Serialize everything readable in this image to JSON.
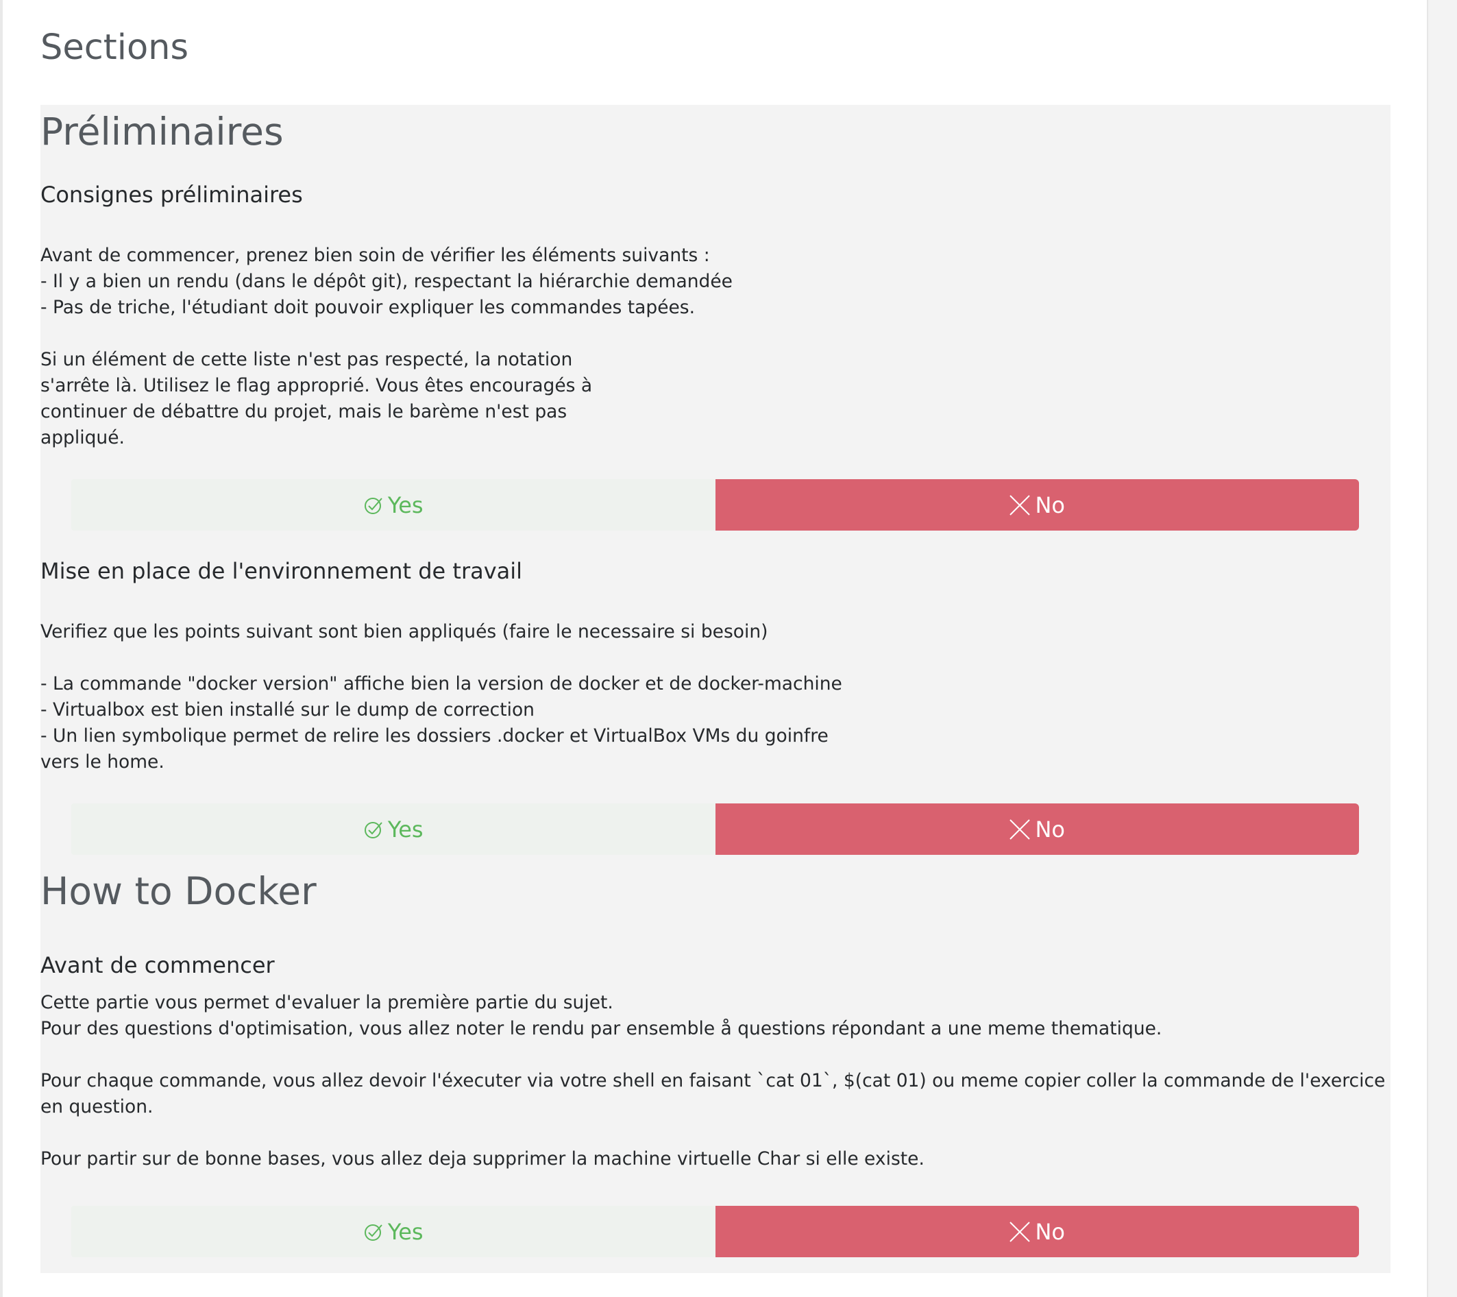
{
  "page": {
    "title": "Sections"
  },
  "sections": [
    {
      "title": "Préliminaires",
      "questions": [
        {
          "title": "Consignes préliminaires",
          "text": "Avant de commencer, prenez bien soin de vérifier les éléments suivants :\n- Il y a bien un rendu (dans le dépôt git), respectant la hiérarchie demandée\n- Pas de triche, l'étudiant doit pouvoir expliquer les commandes tapées.\n\nSi un élément de cette liste n'est pas respecté, la notation\ns'arrête là. Utilisez le flag approprié. Vous êtes encouragés à\ncontinuer de débattre du projet, mais le barème n'est pas\nappliqué.",
          "yes_label": "Yes",
          "no_label": "No"
        },
        {
          "title": "Mise en place de l'environnement de travail",
          "text": "Verifiez que les points suivant sont bien appliqués (faire le necessaire si besoin)\n\n- La commande \"docker version\" affiche bien la version de docker et de docker-machine\n- Virtualbox est bien installé sur le dump de correction\n- Un lien symbolique permet de relire les dossiers .docker et VirtualBox VMs du goinfre\nvers le home.",
          "yes_label": "Yes",
          "no_label": "No"
        }
      ]
    },
    {
      "title": "How to Docker",
      "questions": [
        {
          "title": "Avant de commencer",
          "text": "Cette partie vous permet d'evaluer la première partie du sujet.\nPour des questions d'optimisation, vous allez noter le rendu par ensemble å questions répondant a une meme thematique.\n\nPour chaque commande, vous allez devoir l'éxecuter via votre shell en faisant `cat 01`, $(cat 01) ou meme copier coller la commande de l'exercice en question.\n\nPour partir sur de bonne bases, vous allez deja supprimer la machine virtuelle Char si elle existe.",
          "yes_label": "Yes",
          "no_label": "No"
        }
      ]
    }
  ],
  "colors": {
    "yes_bg": "#eef2ee",
    "yes_text": "#5cb85c",
    "no_bg": "#d9616f",
    "panel_bg": "#f3f3f3"
  },
  "icons": {
    "yes": "check-circle-icon",
    "no": "close-icon"
  }
}
